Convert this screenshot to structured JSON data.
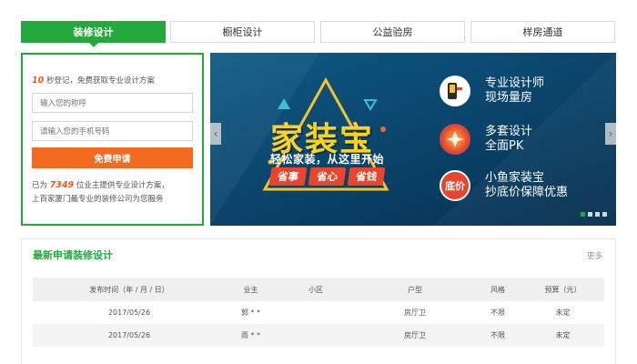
{
  "tabs": [
    {
      "label": "装修设计",
      "active": true
    },
    {
      "label": "橱柜设计",
      "active": false
    },
    {
      "label": "公益验房",
      "active": false
    },
    {
      "label": "样房通道",
      "active": false
    }
  ],
  "form": {
    "intro_num": "10",
    "intro_text": "秒登记，免费获取专业设计方案",
    "name_placeholder": "输入您的称呼",
    "phone_placeholder": "请输入您的手机号码",
    "submit_label": "免费申请",
    "note_prefix": "已为",
    "note_num": "7349",
    "note_suffix": "位业主提供专业设计方案，",
    "note_line2": "上百家厦门最专业的装修公司为您服务"
  },
  "banner": {
    "brand": "家装宝",
    "tagline": "轻松家装，从这里开始",
    "pills": [
      "省事",
      "省心",
      "省钱"
    ],
    "features": [
      {
        "icon": "ruler-icon",
        "line1": "专业设计师",
        "line2": "现场量房"
      },
      {
        "icon": "vs-icon",
        "line1": "多套设计",
        "line2": "全面PK"
      },
      {
        "icon": "bottom-price-icon",
        "icon_text": "底价",
        "line1": "小鱼家装宝",
        "line2": "抄底价保障优惠"
      }
    ],
    "prev_symbol": "‹",
    "next_symbol": "›",
    "slides": 4,
    "active_slide": 1,
    "accent_color": "#23a93b"
  },
  "latest": {
    "title": "最新申请装修设计",
    "more": "更多",
    "columns": [
      "发布时间（年 / 月 / 日）",
      "业主",
      "小区",
      "户型",
      "风格",
      "预算（元）"
    ],
    "rows": [
      [
        "2017/05/26",
        "郭 * *",
        "",
        "房厅卫",
        "不限",
        "未定"
      ],
      [
        "2017/05/26",
        "雨 * *",
        "",
        "房厅卫",
        "不限",
        "未定"
      ]
    ]
  },
  "colors": {
    "green": "#23a93b",
    "orange": "#f26b21",
    "banner_bg": "#0a4268"
  }
}
